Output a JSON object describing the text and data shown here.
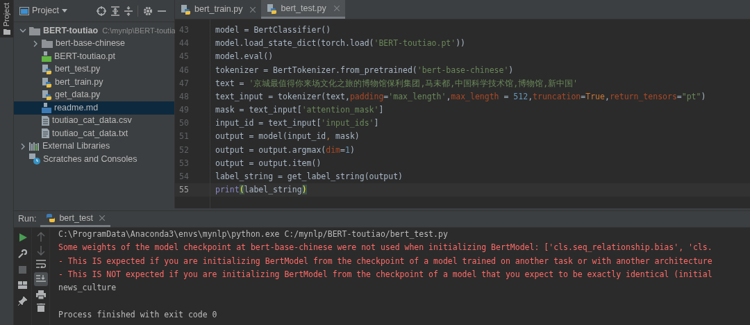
{
  "tool_strip": {
    "label": "Project",
    "selected": true
  },
  "project_panel": {
    "title": "Project",
    "tree": [
      {
        "label": "BERT-toutiao",
        "path": "C:\\mynlp\\BERT-toutia",
        "kind": "folder",
        "expanded": true,
        "selected": false,
        "children": [
          {
            "label": "bert-base-chinese",
            "kind": "folder",
            "expanded": false,
            "selected": false
          },
          {
            "label": "BERT-toutiao.pt",
            "kind": "binary",
            "selected": false
          },
          {
            "label": "bert_test.py",
            "kind": "python",
            "selected": false
          },
          {
            "label": "bert_train.py",
            "kind": "python",
            "selected": false
          },
          {
            "label": "get_data.py",
            "kind": "python",
            "selected": false
          },
          {
            "label": "readme.md",
            "kind": "markdown",
            "selected": true
          },
          {
            "label": "toutiao_cat_data.csv",
            "kind": "csv",
            "selected": false
          },
          {
            "label": "toutiao_cat_data.txt",
            "kind": "text",
            "selected": false
          }
        ]
      },
      {
        "label": "External Libraries",
        "kind": "libraries",
        "expanded": false,
        "selected": false
      },
      {
        "label": "Scratches and Consoles",
        "kind": "scratches",
        "selected": false
      }
    ]
  },
  "editor_tabs": [
    {
      "label": "bert_train.py",
      "selected": false
    },
    {
      "label": "bert_test.py",
      "selected": true
    }
  ],
  "code": [
    {
      "number": "43",
      "current": false,
      "segments": [
        {
          "kind": "plain",
          "text": "model = BertClassifier()"
        }
      ]
    },
    {
      "number": "44",
      "current": false,
      "segments": [
        {
          "kind": "plain",
          "text": "model.load_state_dict(torch.load("
        },
        {
          "kind": "string",
          "text": "'BERT-toutiao.pt'"
        },
        {
          "kind": "plain",
          "text": "))"
        }
      ]
    },
    {
      "number": "45",
      "current": false,
      "segments": [
        {
          "kind": "plain",
          "text": "model.eval()"
        }
      ]
    },
    {
      "number": "46",
      "current": false,
      "segments": [
        {
          "kind": "plain",
          "text": "tokenizer = BertTokenizer.from_pretrained("
        },
        {
          "kind": "string",
          "text": "'bert-base-chinese'"
        },
        {
          "kind": "plain",
          "text": ")"
        }
      ]
    },
    {
      "number": "47",
      "current": false,
      "segments": [
        {
          "kind": "plain",
          "text": "text = "
        },
        {
          "kind": "string",
          "text": "'京城最值得你来场文化之旅的博物馆保利集团,马未都,中国科学技术馆,博物馆,新中国'"
        }
      ]
    },
    {
      "number": "48",
      "current": false,
      "segments": [
        {
          "kind": "plain",
          "text": "text_input = tokenizer(text,"
        },
        {
          "kind": "param",
          "text": "padding"
        },
        {
          "kind": "plain",
          "text": "="
        },
        {
          "kind": "string",
          "text": "'max_length'"
        },
        {
          "kind": "plain",
          "text": ","
        },
        {
          "kind": "param",
          "text": "max_length"
        },
        {
          "kind": "plain",
          "text": " = "
        },
        {
          "kind": "number",
          "text": "512"
        },
        {
          "kind": "plain",
          "text": ","
        },
        {
          "kind": "param",
          "text": "truncation"
        },
        {
          "kind": "plain",
          "text": "="
        },
        {
          "kind": "keyword",
          "text": "True"
        },
        {
          "kind": "plain",
          "text": ","
        },
        {
          "kind": "param",
          "text": "return_tensors"
        },
        {
          "kind": "plain",
          "text": "="
        },
        {
          "kind": "string",
          "text": "\"pt\""
        },
        {
          "kind": "plain",
          "text": ")"
        }
      ]
    },
    {
      "number": "49",
      "current": false,
      "segments": [
        {
          "kind": "plain",
          "text": "mask = text_input["
        },
        {
          "kind": "string",
          "text": "'attention_mask'"
        },
        {
          "kind": "plain",
          "text": "]"
        }
      ]
    },
    {
      "number": "50",
      "current": false,
      "segments": [
        {
          "kind": "plain",
          "text": "input_id = text_input["
        },
        {
          "kind": "string",
          "text": "'input_ids'"
        },
        {
          "kind": "plain",
          "text": "]"
        }
      ]
    },
    {
      "number": "51",
      "current": false,
      "segments": [
        {
          "kind": "plain",
          "text": "output = model(input_id"
        },
        {
          "kind": "keyword",
          "text": ","
        },
        {
          "kind": "plain",
          "text": " mask)"
        }
      ]
    },
    {
      "number": "52",
      "current": false,
      "segments": [
        {
          "kind": "plain",
          "text": "output = output.argmax("
        },
        {
          "kind": "param",
          "text": "dim"
        },
        {
          "kind": "plain",
          "text": "="
        },
        {
          "kind": "number",
          "text": "1"
        },
        {
          "kind": "plain",
          "text": ")"
        }
      ]
    },
    {
      "number": "53",
      "current": false,
      "segments": [
        {
          "kind": "plain",
          "text": "output = output.item()"
        }
      ]
    },
    {
      "number": "54",
      "current": false,
      "segments": [
        {
          "kind": "plain",
          "text": "label_string = get_label_string(output)"
        }
      ]
    },
    {
      "number": "55",
      "current": true,
      "segments": [
        {
          "kind": "builtin",
          "text": "print"
        },
        {
          "kind": "brace",
          "text": "("
        },
        {
          "kind": "plain",
          "text": "label_string"
        },
        {
          "kind": "brace",
          "text": ")"
        }
      ]
    }
  ],
  "run_panel": {
    "label": "Run:",
    "tab": "bert_test",
    "console": [
      {
        "kind": "normal",
        "text": "C:\\ProgramData\\Anaconda3\\envs\\mynlp\\python.exe C:/mynlp/BERT-toutiao/bert_test.py"
      },
      {
        "kind": "error",
        "text": "Some weights of the model checkpoint at bert-base-chinese were not used when initializing BertModel: ['cls.seq_relationship.bias', 'cls."
      },
      {
        "kind": "error",
        "text": "- This IS expected if you are initializing BertModel from the checkpoint of a model trained on another task or with another architecture"
      },
      {
        "kind": "error",
        "text": "- This IS NOT expected if you are initializing BertModel from the checkpoint of a model that you expect to be exactly identical (initial"
      },
      {
        "kind": "normal",
        "text": "news_culture"
      },
      {
        "kind": "blank"
      },
      {
        "kind": "normal",
        "text": "Process finished with exit code 0"
      }
    ]
  }
}
